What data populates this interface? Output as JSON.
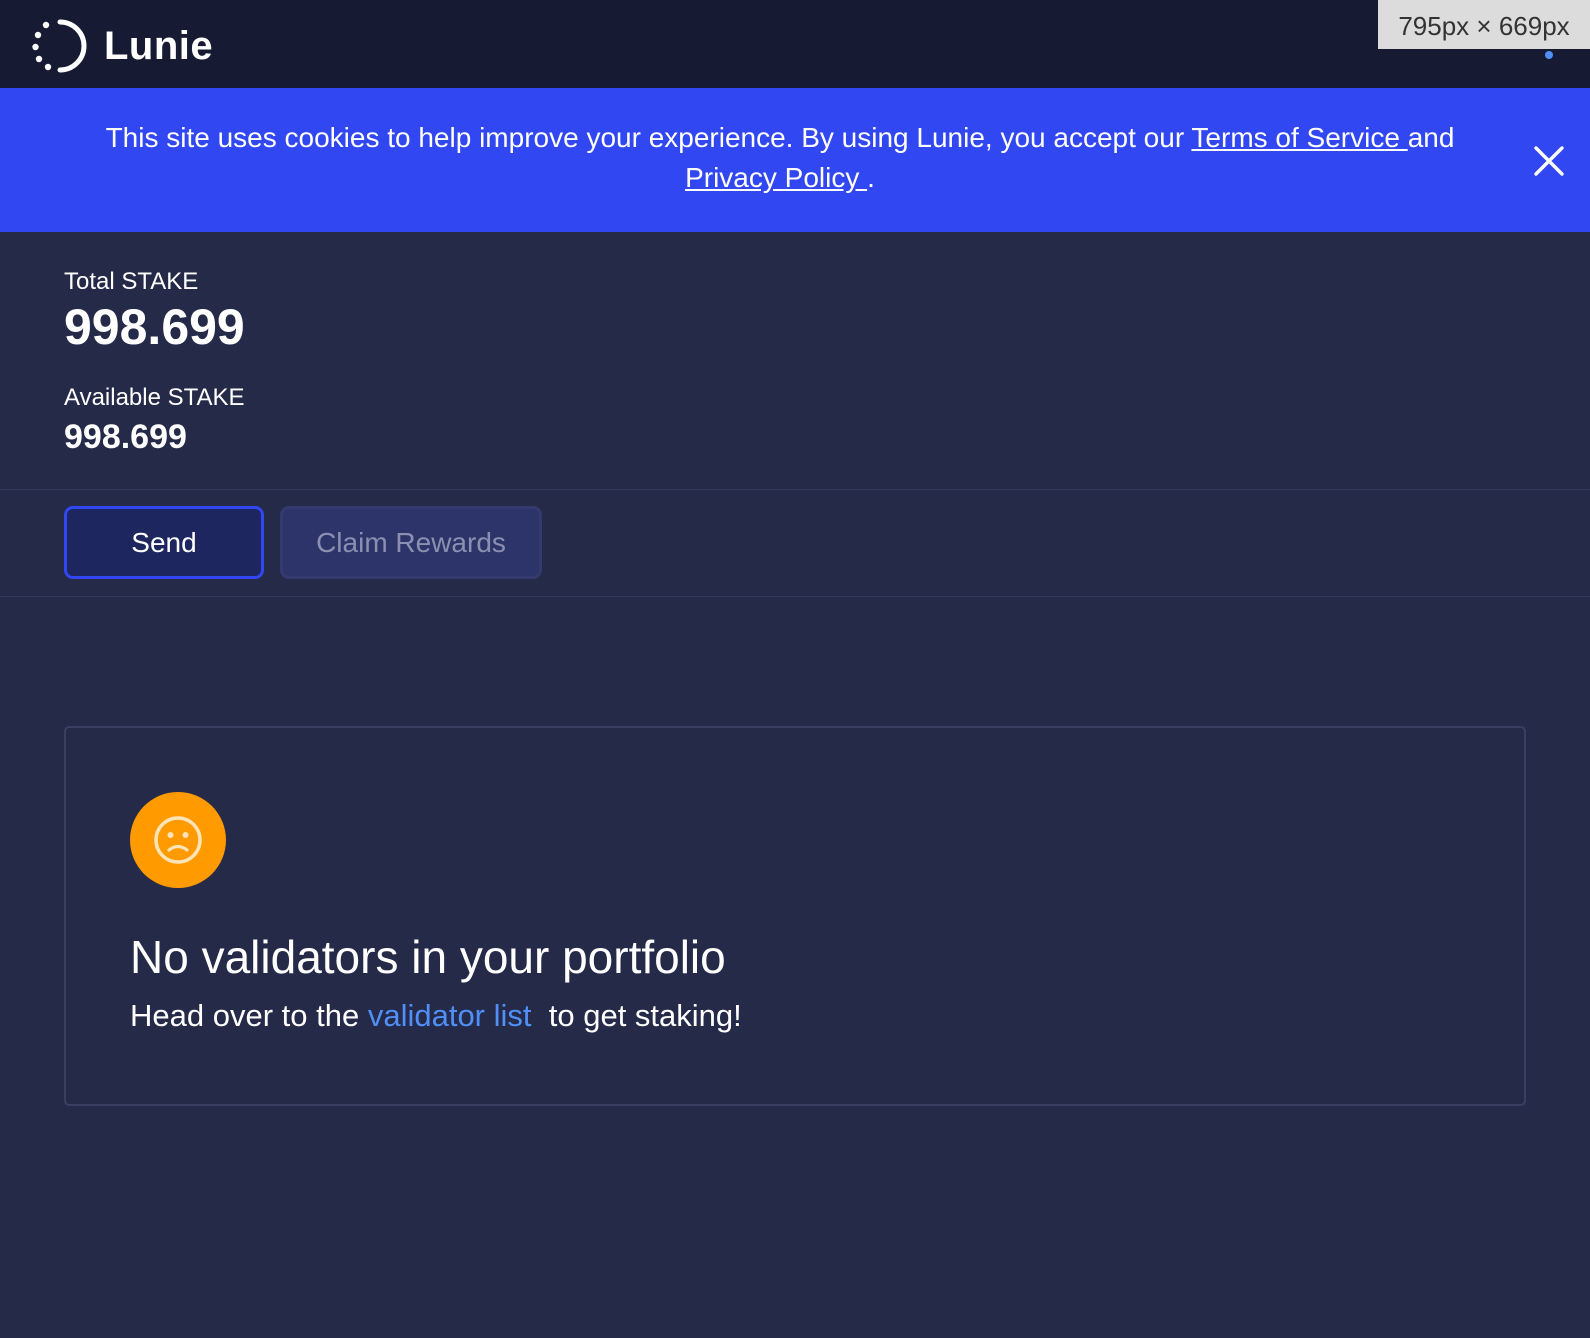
{
  "app": {
    "name": "Lunie"
  },
  "overlay": {
    "dimensions": "795px × 669px"
  },
  "cookie_banner": {
    "text_before": "This site uses cookies to help improve your experience. By using Lunie, you accept our ",
    "terms_link": "Terms of Service ",
    "text_middle": "and ",
    "privacy_link": "Privacy Policy ",
    "text_after": "."
  },
  "balances": {
    "total_label": "Total STAKE",
    "total_value": "998.699",
    "available_label": "Available STAKE",
    "available_value": "998.699"
  },
  "actions": {
    "send_label": "Send",
    "claim_label": "Claim Rewards"
  },
  "empty_state": {
    "icon": "sad-face-icon",
    "title": "No validators in your portfolio",
    "text_before": "Head over to the ",
    "link_text": "validator list",
    "text_after": "  to get staking!"
  },
  "colors": {
    "header_bg": "#161b33",
    "page_bg": "#262a49",
    "banner_bg": "#3047f2",
    "accent_orange": "#ff9a00",
    "link_blue": "#4f8ff7"
  }
}
